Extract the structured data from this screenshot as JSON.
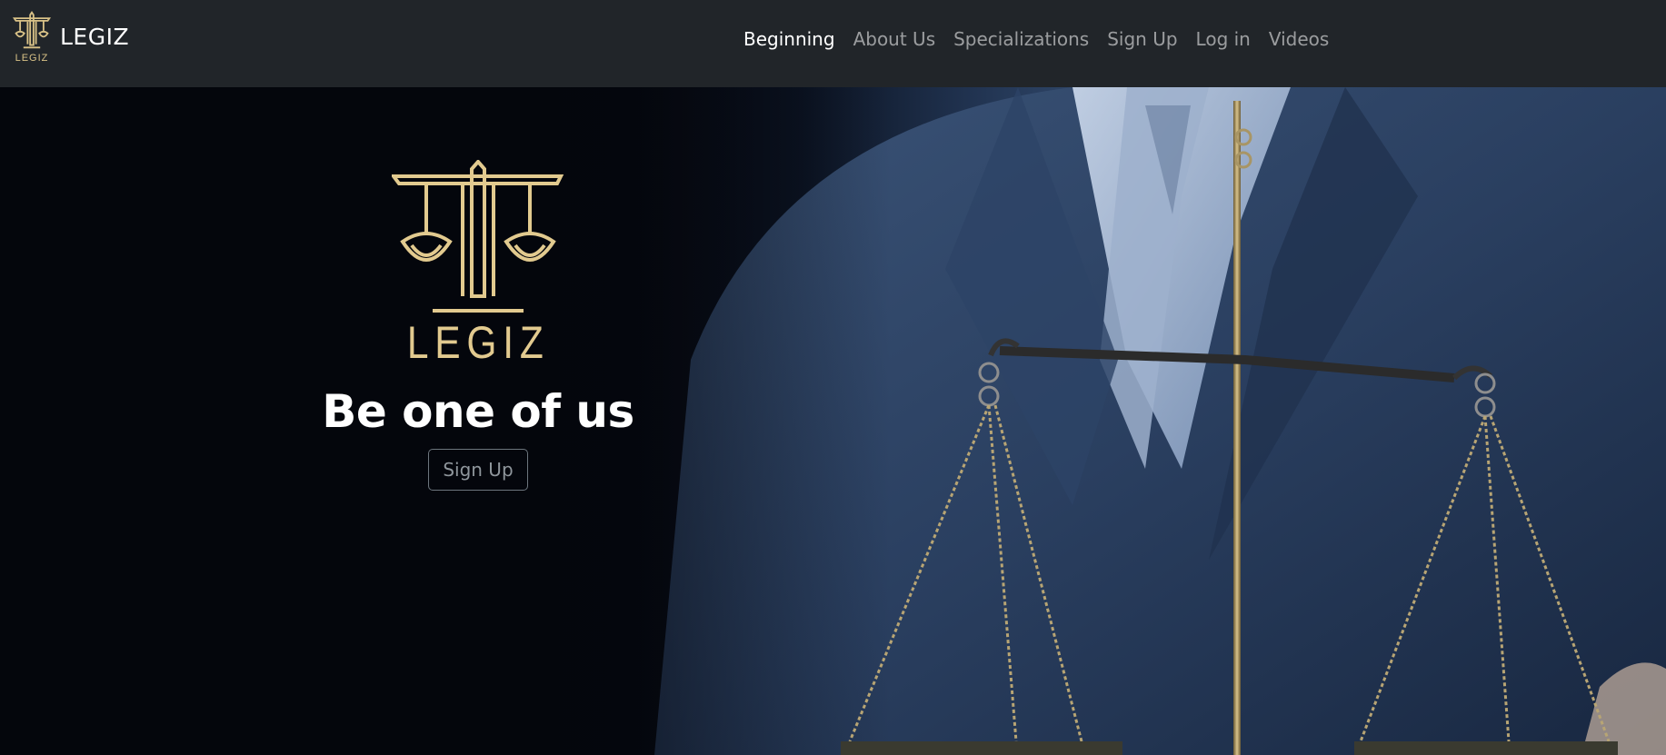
{
  "brand": {
    "name": "LEGIZ",
    "logo_text": "LEGIZ",
    "logo_color": "#d9c287"
  },
  "nav": {
    "items": [
      {
        "label": "Beginning",
        "active": true
      },
      {
        "label": "About Us",
        "active": false
      },
      {
        "label": "Specializations",
        "active": false
      },
      {
        "label": "Sign Up",
        "active": false
      },
      {
        "label": "Log in",
        "active": false
      },
      {
        "label": "Videos",
        "active": false
      }
    ]
  },
  "hero": {
    "logo_text": "LEGIZ",
    "title": "Be one of us",
    "button_label": "Sign Up",
    "background_image": "scales-of-justice-photo"
  },
  "colors": {
    "navbar_bg": "#212529",
    "gold": "#e2ca8f",
    "nav_active": "#ffffff",
    "nav_inactive": "rgba(255,255,255,0.55)"
  }
}
